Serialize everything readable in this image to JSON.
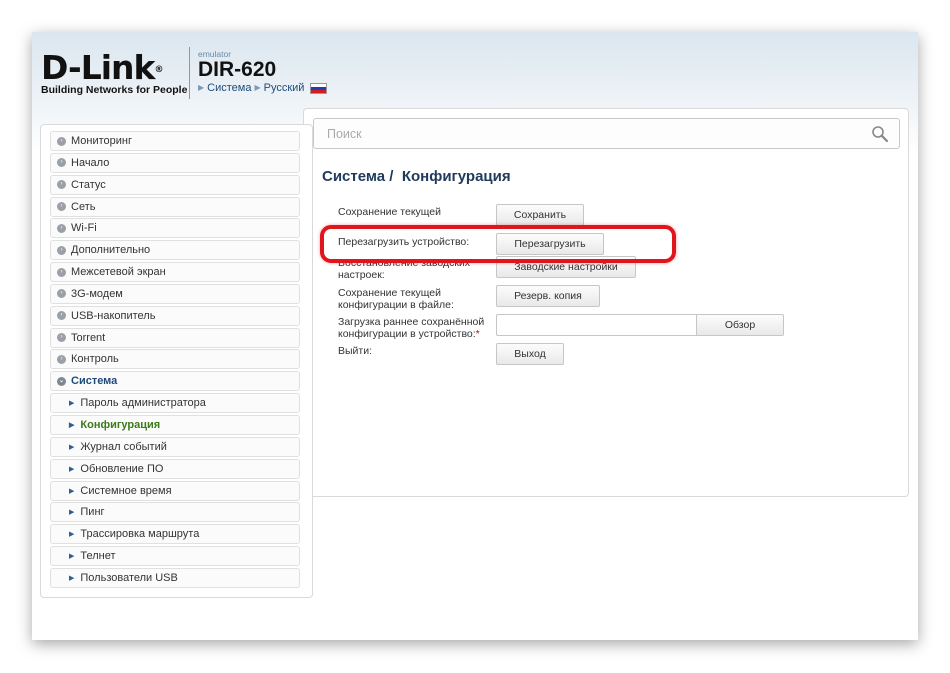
{
  "header": {
    "logo": "D-Link",
    "logo_reg": "®",
    "tagline": "Building Networks for People",
    "emulator": "emulator",
    "model": "DIR-620",
    "breadcrumb_section": "Система",
    "language": "Русский"
  },
  "sidebar": {
    "items": [
      {
        "label": "Мониторинг"
      },
      {
        "label": "Начало"
      },
      {
        "label": "Статус"
      },
      {
        "label": "Сеть"
      },
      {
        "label": "Wi-Fi"
      },
      {
        "label": "Дополнительно"
      },
      {
        "label": "Межсетевой экран"
      },
      {
        "label": "3G-модем"
      },
      {
        "label": "USB-накопитель"
      },
      {
        "label": "Torrent"
      },
      {
        "label": "Контроль"
      },
      {
        "label": "Система"
      }
    ],
    "subitems": [
      {
        "label": "Пароль администратора"
      },
      {
        "label": "Конфигурация"
      },
      {
        "label": "Журнал событий"
      },
      {
        "label": "Обновление ПО"
      },
      {
        "label": "Системное время"
      },
      {
        "label": "Пинг"
      },
      {
        "label": "Трассировка маршрута"
      },
      {
        "label": "Телнет"
      },
      {
        "label": "Пользователи USB"
      }
    ]
  },
  "search": {
    "placeholder": "Поиск"
  },
  "main": {
    "title_section": "Система /",
    "title_page": "Конфигурация",
    "rows": [
      {
        "label": "Сохранение текущей конфигурации:",
        "button": "Сохранить"
      },
      {
        "label": "Перезагрузить устройство:",
        "button": "Перезагрузить"
      },
      {
        "label": "Восстановление заводских настроек:",
        "button": "Заводские настройки"
      },
      {
        "label": "Сохранение текущей конфигурации в файле:",
        "button": "Резерв. копия"
      },
      {
        "label": "Загрузка раннее сохранённой конфигурации в устройство:",
        "required_mark": "*",
        "button": "Обзор"
      },
      {
        "label": "Выйти:",
        "button": "Выход"
      }
    ]
  },
  "colors": {
    "highlight": "#e0161c",
    "title": "#1f3a5a",
    "active_item": "#3a7a1a"
  }
}
